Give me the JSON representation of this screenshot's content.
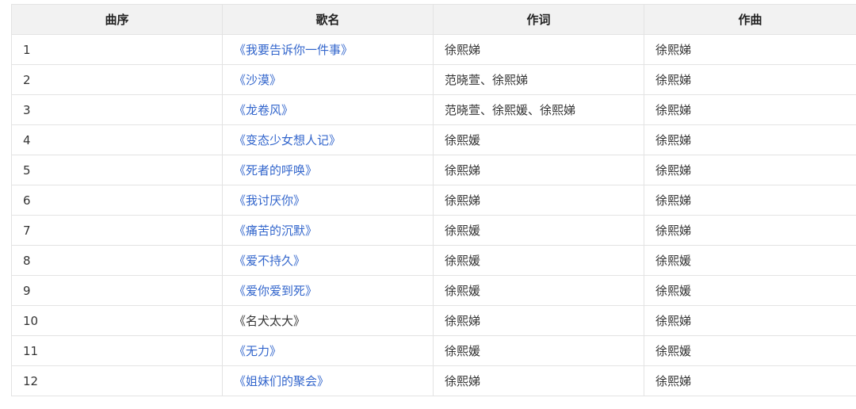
{
  "table": {
    "headers": [
      "曲序",
      "歌名",
      "作词",
      "作曲"
    ],
    "rows": [
      {
        "no": "1",
        "title": "《我要告诉你一件事》",
        "linked": true,
        "lyricist": "徐熙娣",
        "composer": "徐熙娣"
      },
      {
        "no": "2",
        "title": "《沙漠》",
        "linked": true,
        "lyricist": "范晓萱、徐熙娣",
        "composer": "徐熙娣"
      },
      {
        "no": "3",
        "title": "《龙卷风》",
        "linked": true,
        "lyricist": "范晓萱、徐熙媛、徐熙娣",
        "composer": "徐熙娣"
      },
      {
        "no": "4",
        "title": "《变态少女想人记》",
        "linked": true,
        "lyricist": "徐熙媛",
        "composer": "徐熙娣"
      },
      {
        "no": "5",
        "title": "《死者的呼唤》",
        "linked": true,
        "lyricist": "徐熙娣",
        "composer": "徐熙娣"
      },
      {
        "no": "6",
        "title": "《我讨厌你》",
        "linked": true,
        "lyricist": "徐熙娣",
        "composer": "徐熙娣"
      },
      {
        "no": "7",
        "title": "《痛苦的沉默》",
        "linked": true,
        "lyricist": "徐熙媛",
        "composer": "徐熙娣"
      },
      {
        "no": "8",
        "title": "《爱不持久》",
        "linked": true,
        "lyricist": "徐熙媛",
        "composer": "徐熙媛"
      },
      {
        "no": "9",
        "title": "《爱你爱到死》",
        "linked": true,
        "lyricist": "徐熙媛",
        "composer": "徐熙媛"
      },
      {
        "no": "10",
        "title": "《名犬太大》",
        "linked": false,
        "lyricist": "徐熙娣",
        "composer": "徐熙娣"
      },
      {
        "no": "11",
        "title": "《无力》",
        "linked": true,
        "lyricist": "徐熙媛",
        "composer": "徐熙媛"
      },
      {
        "no": "12",
        "title": "《姐妹们的聚会》",
        "linked": true,
        "lyricist": "徐熙娣",
        "composer": "徐熙娣"
      }
    ]
  },
  "colors": {
    "link": "#3366cc",
    "text": "#333333",
    "header_bg": "#f2f2f2",
    "border": "#e3e3e3"
  }
}
